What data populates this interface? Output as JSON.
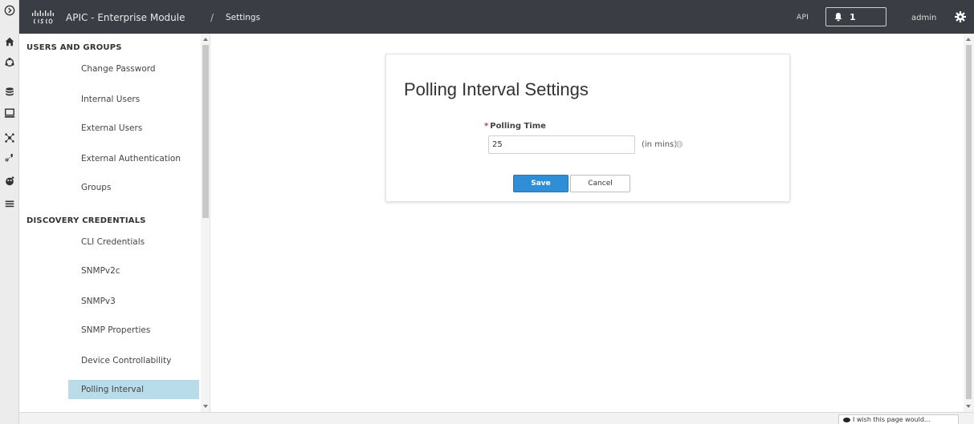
{
  "header": {
    "app_title": "APIC - Enterprise Module",
    "separator": "/",
    "breadcrumb": "Settings",
    "api_label": "API",
    "notification_count": "1",
    "user": "admin"
  },
  "sidebar": {
    "sections": [
      {
        "heading": "USERS AND GROUPS",
        "items": [
          {
            "label": "Change Password"
          },
          {
            "label": "Internal Users"
          },
          {
            "label": "External Users"
          },
          {
            "label": "External Authentication"
          },
          {
            "label": "Groups"
          }
        ]
      },
      {
        "heading": "DISCOVERY CREDENTIALS",
        "items": [
          {
            "label": "CLI Credentials"
          },
          {
            "label": "SNMPv2c"
          },
          {
            "label": "SNMPv3"
          },
          {
            "label": "SNMP Properties"
          },
          {
            "label": "Device Controllability"
          },
          {
            "label": "Polling Interval"
          }
        ]
      }
    ],
    "active_item": "Polling Interval"
  },
  "form": {
    "title": "Polling Interval Settings",
    "required_mark": "*",
    "field_label": "Polling Time",
    "field_value": "25",
    "unit": "(in mins)",
    "save_label": "Save",
    "cancel_label": "Cancel"
  },
  "footer": {
    "feedback_text": "I wish this page would..."
  },
  "rail_icons": [
    "expand-icon",
    "home-icon",
    "topology-icon",
    "database-icon",
    "monitor-icon",
    "network-icon",
    "path-trace-icon",
    "apps-icon",
    "menu-icon"
  ],
  "colors": {
    "topbar": "#3b3d44",
    "active_item": "#b8dcea",
    "primary_button": "#2f8ed6",
    "required": "#d9333a"
  }
}
